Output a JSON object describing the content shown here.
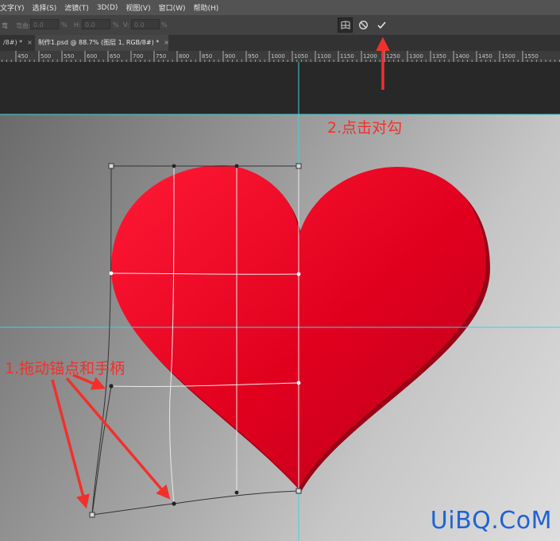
{
  "menu": [
    "文字(Y)",
    "选择(S)",
    "滤镜(T)",
    "3D(D)",
    "视图(V)",
    "窗口(W)",
    "帮助(H)"
  ],
  "options": {
    "tool_fragment": "弯",
    "bend_label": "弯曲:",
    "bend_value": "0.0",
    "h_label": "H:",
    "h_value": "0.0",
    "v_label": "V:",
    "v_value": "0.0",
    "unit": "%"
  },
  "tabs": [
    {
      "label": "/8#) *",
      "close": "×"
    },
    {
      "label": "制作1.psd @ 88.7% (图层 1, RGB/8#) *",
      "close": "×"
    }
  ],
  "ruler_ticks": [
    "450",
    "500",
    "550",
    "600",
    "650",
    "700",
    "750",
    "800",
    "850",
    "900",
    "950",
    "1000",
    "1050",
    "1100",
    "1150",
    "1200",
    "1250",
    "1300",
    "1350",
    "1400",
    "1450",
    "1500",
    "1550"
  ],
  "annotations": {
    "step1": "1.拖动锚点和手柄",
    "step2": "2.点击对勾"
  },
  "watermark": "UiBQ.CoM",
  "colors": {
    "arrow": "#f2302b",
    "guide": "#3fd3dc",
    "heart_light": "#ff1a34",
    "heart_dark": "#c0001f"
  }
}
